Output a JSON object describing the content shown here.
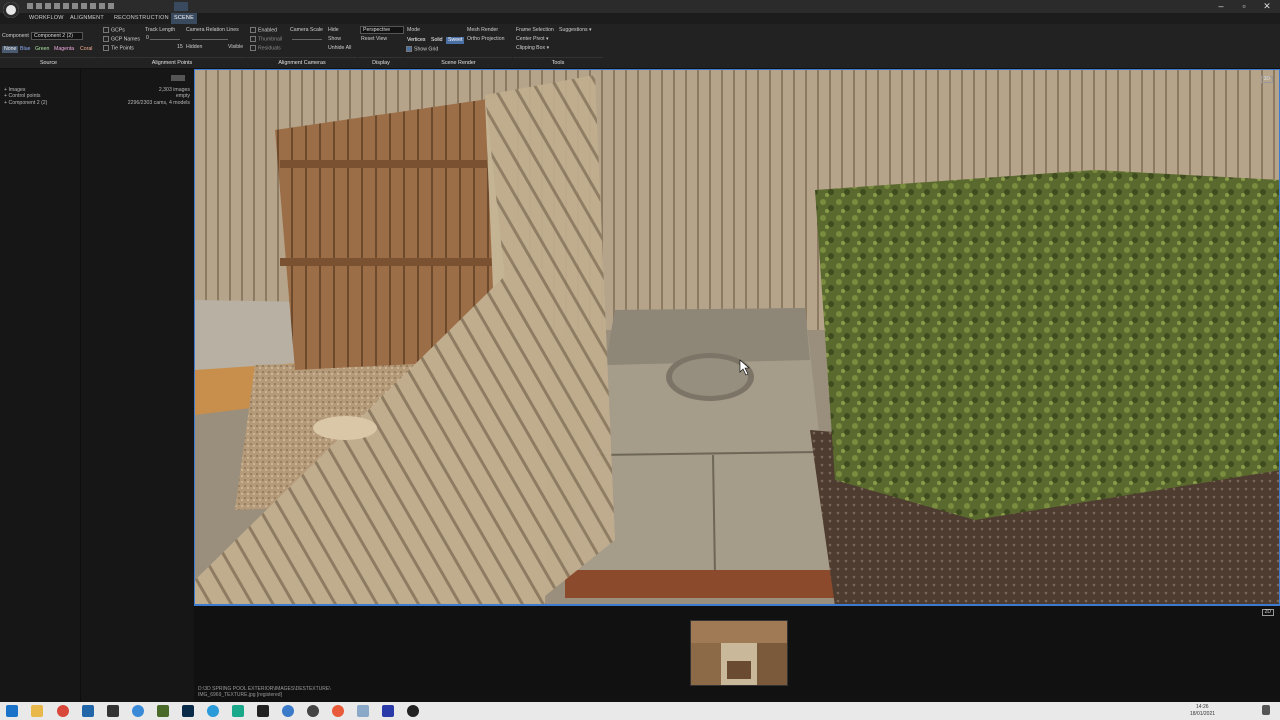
{
  "titlebar": {
    "window_controls": [
      "minimize-icon",
      "maximize-icon",
      "close-icon"
    ]
  },
  "tabs": [
    {
      "label": "Workflow",
      "active": false
    },
    {
      "label": "Alignment",
      "active": false
    },
    {
      "label": "Reconstruction",
      "active": false
    },
    {
      "label": "Scene",
      "active": true
    }
  ],
  "ribbon": {
    "source": {
      "component_label": "Component",
      "component_value": "Component 2 (2)",
      "colors": [
        "None",
        "Blue",
        "Green",
        "Magenta",
        "Coral"
      ],
      "group": "Source"
    },
    "alignment_points": {
      "gcps": "GCPs",
      "gcp_names": "GCP Names",
      "tie_points": "Tie Points",
      "track_length": "Track Length",
      "slider_min": "0",
      "slider_max": "15",
      "hidden": "Hidden",
      "visible": "Visible",
      "camera_relation_lines": "Camera Relation Lines",
      "enabled": "Enabled",
      "thumbnail": "Thumbnail",
      "residuals": "Residuals",
      "group": "Alignment Points"
    },
    "alignment_cameras": {
      "camera_scale": "Camera Scale",
      "hide": "Hide",
      "show": "Show",
      "unhide_all": "Unhide All",
      "group": "Alignment Cameras"
    },
    "display": {
      "projection": "Perspective",
      "reset_view": "Reset View",
      "group": "Display"
    },
    "scene_render": {
      "mode": "Mode",
      "vertices": "Vertices",
      "solid": "Solid",
      "sweet": "Sweet",
      "mesh_render": "Mesh Render",
      "ortho_projection": "Ortho Projection",
      "show_grid": "Show Grid",
      "group": "Scene Render"
    },
    "tools": {
      "frame_selection": "Frame Selection",
      "suggestions": "Suggestions",
      "center_pivot": "Center Pivot",
      "clipping_box": "Clipping Box",
      "group": "Tools"
    }
  },
  "left_panel": {
    "tree": [
      "Images",
      "Control points",
      "Component 2 (2)"
    ],
    "details": [
      "2,303 images",
      "empty",
      "2296/2303 cams, 4 models"
    ]
  },
  "viewport": {
    "label": "3D",
    "bottom_label": "2D"
  },
  "bottom_pane": {
    "path_line1": "D:\\3D SPRING POOL EXTERIOR\\IMAGES\\DESTEXTURE\\",
    "path_line2": "IMG_6969_TEXTURE.jpg [registered]"
  },
  "taskbar": {
    "icons": [
      "windows-start-icon",
      "file-explorer-icon",
      "chrome-icon",
      "app-icon",
      "app-icon",
      "chrome-icon",
      "photoshop-icon",
      "edge-icon",
      "app-icon",
      "app-icon",
      "app-icon",
      "app-icon",
      "app-icon",
      "app-icon"
    ],
    "time": "14:26",
    "date": "18/01/2021"
  }
}
